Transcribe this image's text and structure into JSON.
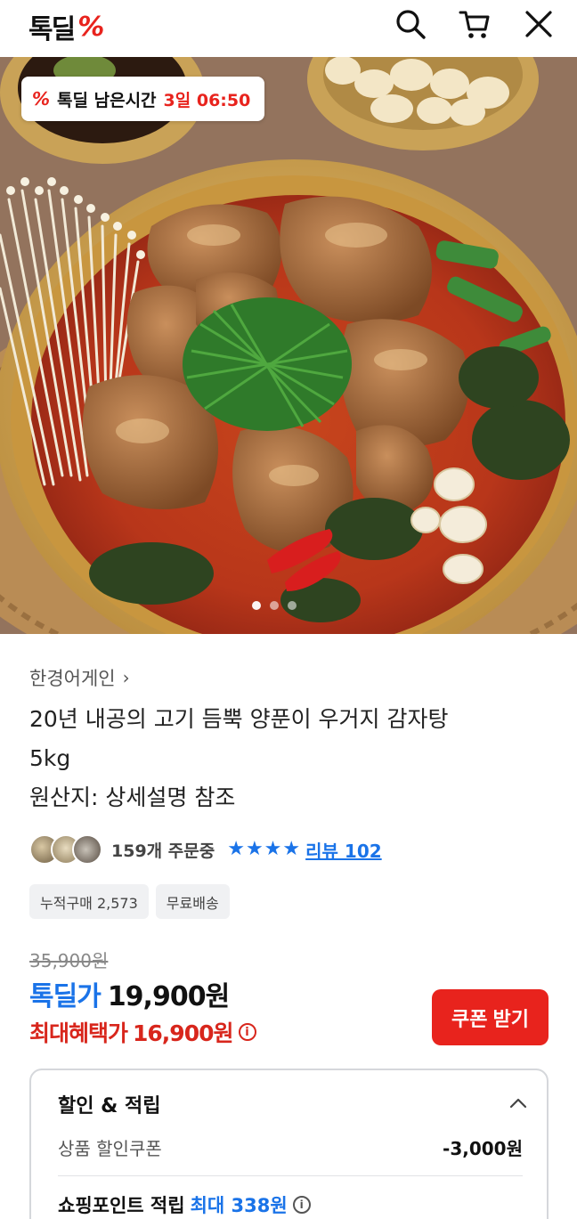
{
  "header": {
    "logo_text": "톡딜",
    "logo_mark": "%",
    "icons": [
      "search-icon",
      "cart-icon",
      "close-icon"
    ]
  },
  "hero": {
    "badge_mark": "%",
    "badge_label": "톡딜 남은시간",
    "badge_time": "3일 06:50",
    "slide_count": 3,
    "active_slide": 1
  },
  "product": {
    "seller": "한경어게인",
    "seller_chevron": "›",
    "title_line1": "20년 내공의 고기 듬뿍 양푼이 우거지 감자탕",
    "title_line2": "5kg",
    "origin": "원산지: 상세설명 참조",
    "orders_text": "159개 주문중",
    "rating_stars": 4,
    "review_link": "리뷰 102",
    "tags": [
      "누적구매 2,573",
      "무료배송"
    ]
  },
  "price": {
    "original": "35,900원",
    "deal_label": "톡딜가",
    "deal_value": "19,900원",
    "max_label": "최대혜택가",
    "max_value": "16,900원",
    "info_glyph": "i",
    "coupon_button": "쿠폰 받기"
  },
  "discount": {
    "heading": "할인 & 적립",
    "row1_key": "상품 할인쿠폰",
    "row1_value": "-3,000원",
    "row2_key": "쇼핑포인트 적립",
    "row2_highlight": "최대 338원",
    "row2_info_glyph": "i"
  },
  "colors": {
    "brand_red": "#e8231d",
    "accent_blue": "#1a73e8",
    "price_red": "#d8261c"
  }
}
